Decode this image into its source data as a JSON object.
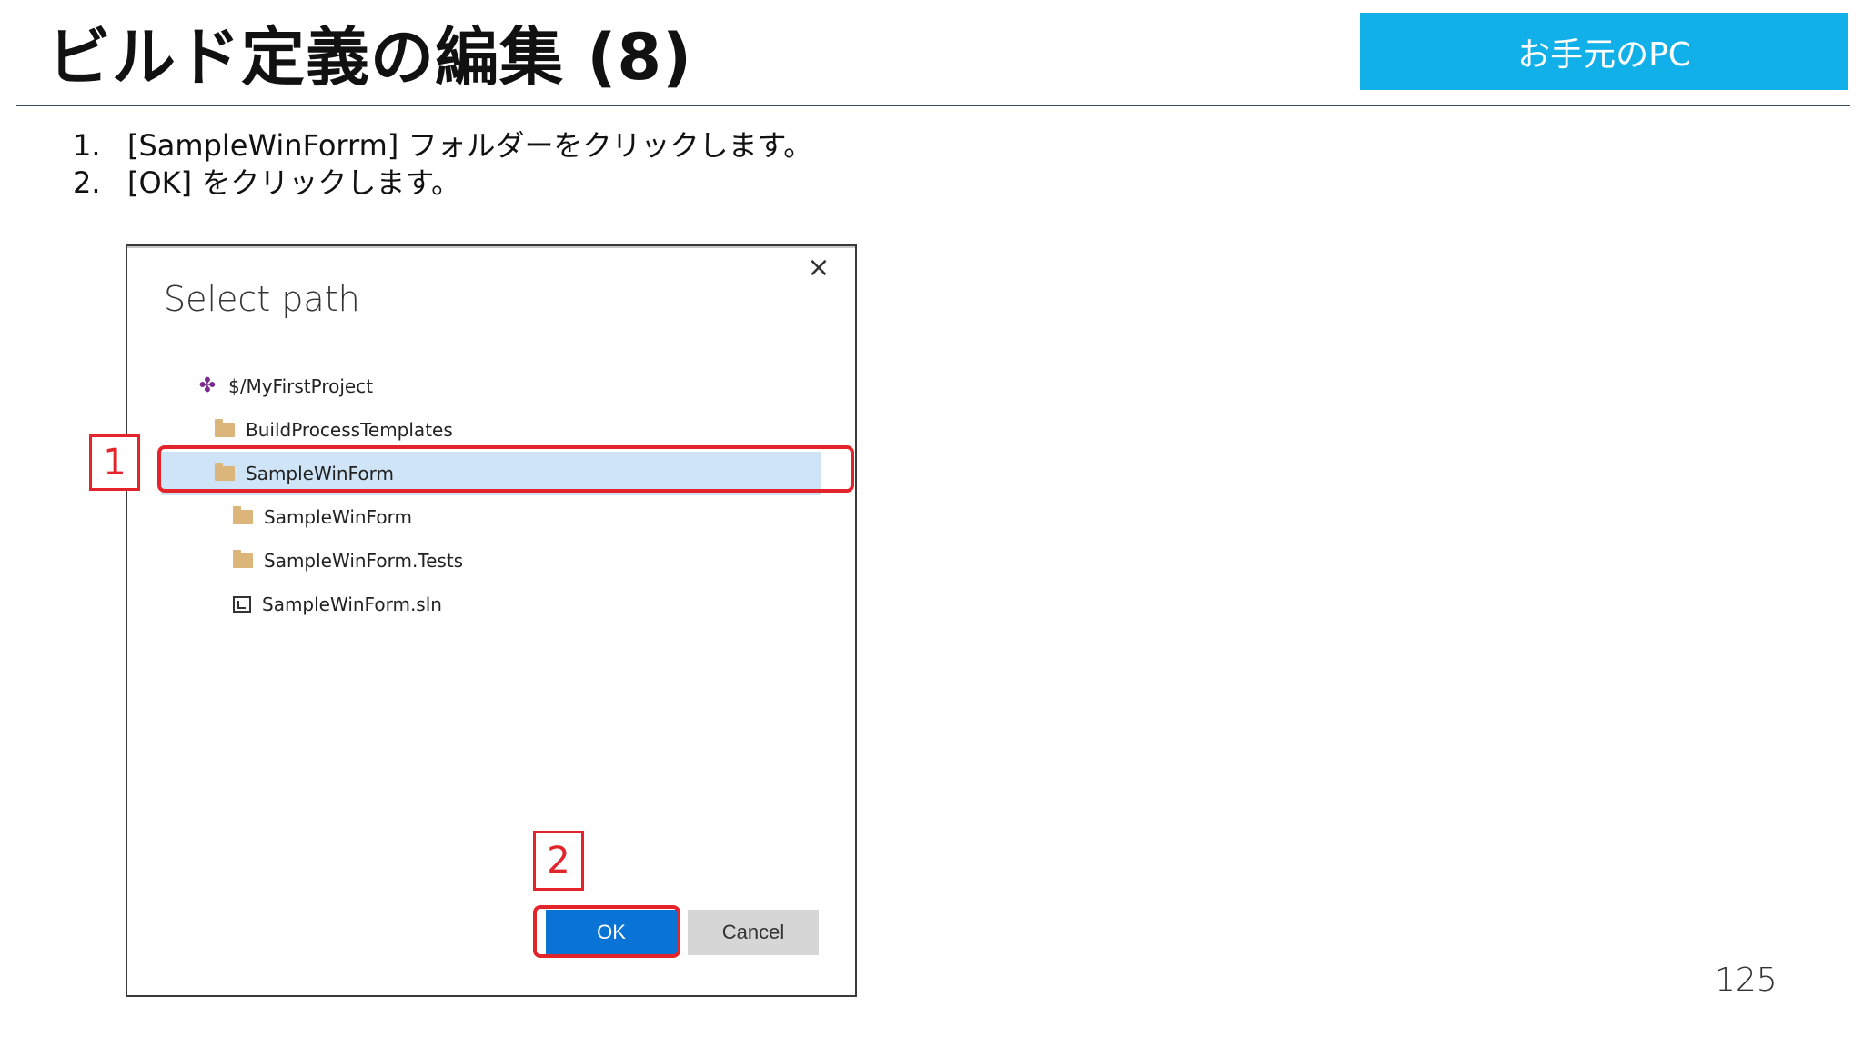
{
  "slide": {
    "title": "ビルド定義の編集 (8)",
    "badge": "お手元のPC",
    "page_number": "125"
  },
  "steps": [
    {
      "num": "1.",
      "text": "[SampleWinForrm] フォルダーをクリックします。"
    },
    {
      "num": "2.",
      "text": "[OK] をクリックします。"
    }
  ],
  "dialog": {
    "title": "Select path",
    "close_glyph": "×",
    "tree": [
      {
        "label": "$/MyFirstProject",
        "icon": "team-project-icon"
      },
      {
        "label": "BuildProcessTemplates",
        "icon": "folder-icon"
      },
      {
        "label": "SampleWinForm",
        "icon": "folder-icon",
        "selected": true
      },
      {
        "label": "SampleWinForm",
        "icon": "folder-icon"
      },
      {
        "label": "SampleWinForm.Tests",
        "icon": "folder-icon"
      },
      {
        "label": "SampleWinForm.sln",
        "icon": "solution-file-icon"
      }
    ],
    "ok_label": "OK",
    "cancel_label": "Cancel"
  },
  "callouts": [
    {
      "number": "1"
    },
    {
      "number": "2"
    }
  ],
  "colors": {
    "badge": "#12b0e8",
    "callout": "#e3242b",
    "ok_button": "#0a74d6",
    "selected_row": "#cfe5f7",
    "folder": "#dcb57a"
  }
}
